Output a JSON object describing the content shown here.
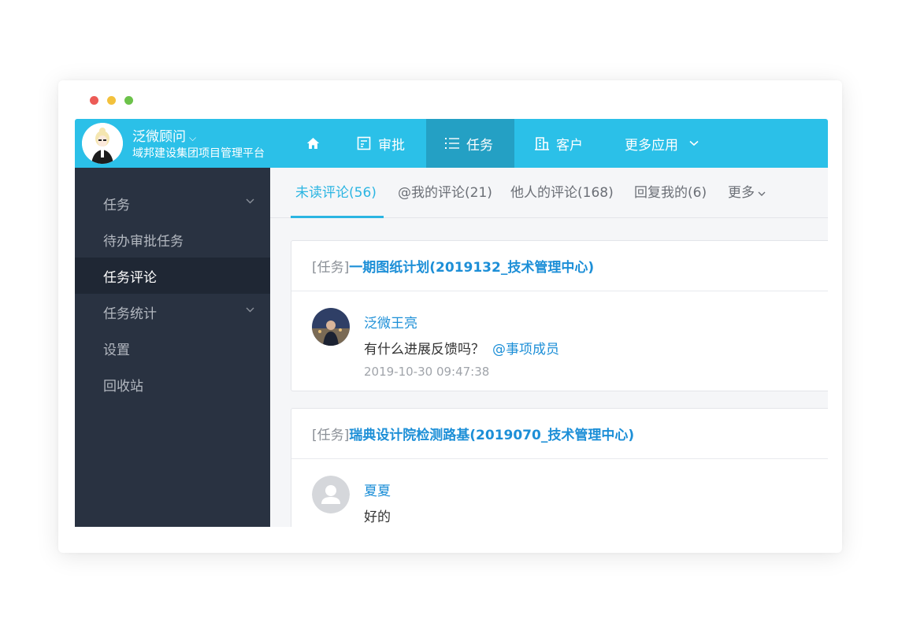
{
  "user": {
    "name": "泛微顾问",
    "org": "域邦建设集团项目管理平台"
  },
  "nav": {
    "home_icon": "home-icon",
    "items": [
      {
        "label": "审批",
        "icon": "approval-icon"
      },
      {
        "label": "任务",
        "icon": "list-icon",
        "active": true
      },
      {
        "label": "客户",
        "icon": "building-icon"
      },
      {
        "label": "更多应用",
        "icon": "chevron-down-icon"
      }
    ]
  },
  "sidebar": {
    "items": [
      {
        "label": "任务",
        "has_arrow": true
      },
      {
        "label": "待办审批任务"
      },
      {
        "label": "任务评论",
        "active": true
      },
      {
        "label": "任务统计",
        "has_arrow": true
      },
      {
        "label": "设置"
      },
      {
        "label": "回收站"
      }
    ]
  },
  "tabs": [
    {
      "label": "未读评论(56)",
      "active": true
    },
    {
      "label": "@我的评论(21)"
    },
    {
      "label": "他人的评论(168)"
    },
    {
      "label": "回复我的(6)"
    },
    {
      "label": "更多"
    }
  ],
  "cards": [
    {
      "tag": "[任务]",
      "title": "一期图纸计划(2019132_技术管理中心)",
      "comment": {
        "author": "泛微王亮",
        "text": "有什么进展反馈吗？",
        "mention": "@事项成员",
        "time": "2019-10-30 09:47:38"
      }
    },
    {
      "tag": "[任务]",
      "title": "瑞典设计院检测路基(2019070_技术管理中心)",
      "comment": {
        "author": "夏夏",
        "text": "好的"
      }
    }
  ],
  "colors": {
    "topbar": "#2bc0e8",
    "topbar_active": "#24a0c4",
    "sidebar": "#293241",
    "link": "#1d8fd7",
    "tab_active": "#2bb5e2"
  }
}
